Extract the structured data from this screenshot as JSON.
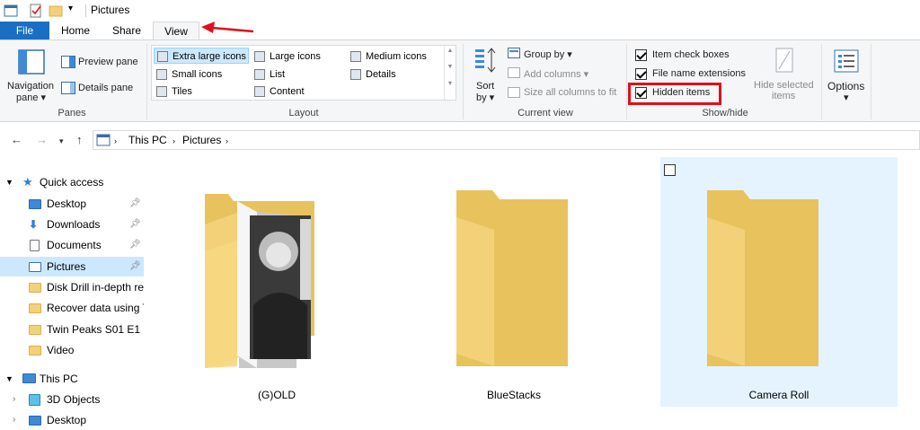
{
  "window": {
    "title": "Pictures"
  },
  "tabs": [
    {
      "label": "File"
    },
    {
      "label": "Home"
    },
    {
      "label": "Share"
    },
    {
      "label": "View"
    }
  ],
  "ribbon": {
    "panes": {
      "navigation_pane": "Navigation",
      "navigation_pane_2": "pane ▾",
      "preview_pane": "Preview pane",
      "details_pane": "Details pane",
      "label": "Panes"
    },
    "layout": {
      "label": "Layout",
      "options": [
        {
          "label": "Extra large icons",
          "selected": true
        },
        {
          "label": "Large icons"
        },
        {
          "label": "Medium icons"
        },
        {
          "label": "Small icons"
        },
        {
          "label": "List"
        },
        {
          "label": "Details"
        },
        {
          "label": "Tiles"
        },
        {
          "label": "Content"
        }
      ]
    },
    "current_view": {
      "label": "Current view",
      "sort_by": "Sort",
      "sort_by_2": "by ▾",
      "group_by": "Group by ▾",
      "add_columns": "Add columns ▾",
      "size_all_columns": "Size all columns to fit"
    },
    "show_hide": {
      "label": "Show/hide",
      "item_check_boxes": "Item check boxes",
      "file_name_extensions": "File name extensions",
      "hidden_items": "Hidden items",
      "hide_selected": "Hide selected",
      "hide_selected_2": "items"
    },
    "options": {
      "label": "Options",
      "label_2": "▾"
    }
  },
  "address": {
    "crumbs": [
      "This PC",
      "Pictures"
    ]
  },
  "nav": {
    "items": [
      {
        "label": "Quick access"
      },
      {
        "label": "Desktop"
      },
      {
        "label": "Downloads"
      },
      {
        "label": "Documents"
      },
      {
        "label": "Pictures"
      },
      {
        "label": "Disk Drill in-depth re"
      },
      {
        "label": "Recover data using T"
      },
      {
        "label": "Twin Peaks S01 E1"
      },
      {
        "label": "Video"
      },
      {
        "label": "This PC"
      },
      {
        "label": "3D Objects"
      },
      {
        "label": "Desktop"
      }
    ]
  },
  "files": [
    {
      "name": "(G)OLD"
    },
    {
      "name": "BlueStacks"
    },
    {
      "name": "Camera Roll",
      "selected": true
    }
  ],
  "colors": {
    "file_tab": "#1a6fc4",
    "highlight_red": "#e0101a",
    "selection": "#cce8ff"
  }
}
